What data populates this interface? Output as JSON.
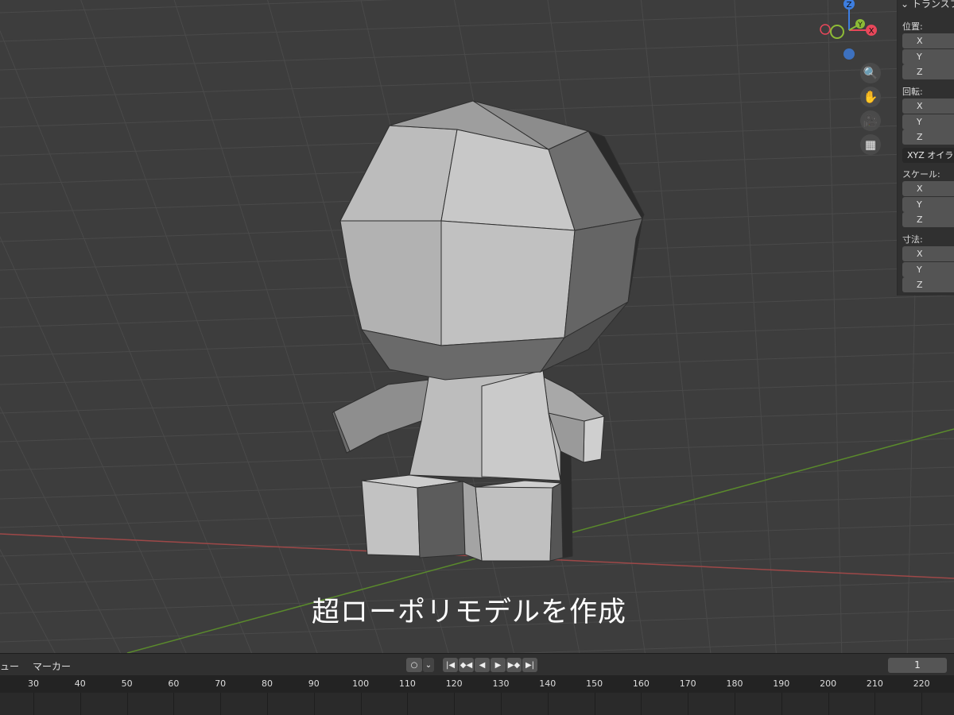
{
  "caption": "超ローポリモデルを作成",
  "gizmo": {
    "axis_z": "Z",
    "axis_x": "X",
    "axis_y": "Y",
    "colors": {
      "x": "#e8475a",
      "y": "#8dbb36",
      "z": "#3d7ee0"
    }
  },
  "nav_buttons": [
    {
      "name": "zoom-icon",
      "glyph": "🔍"
    },
    {
      "name": "pan-hand-icon",
      "glyph": "✋"
    },
    {
      "name": "camera-icon",
      "glyph": "🎥"
    },
    {
      "name": "grid-ortho-icon",
      "glyph": "▦"
    }
  ],
  "npanel": {
    "header": "トランスフ",
    "location_label": "位置:",
    "rotation_label": "回転:",
    "rotation_mode": "XYZ オイラ",
    "scale_label": "スケール:",
    "dimensions_label": "寸法:",
    "axis_x": "X",
    "axis_y": "Y",
    "axis_z": "Z"
  },
  "timeline": {
    "menu_view": "ビュー",
    "menu_marker": "マーカー",
    "current_frame": "1",
    "ticks": [
      "30",
      "40",
      "50",
      "60",
      "70",
      "80",
      "90",
      "100",
      "110",
      "120",
      "130",
      "140",
      "150",
      "160",
      "170",
      "180",
      "190",
      "200",
      "210",
      "220"
    ],
    "icons": {
      "record": "○",
      "dropdown": "⌄",
      "jump_start": "|◀",
      "prev_key": "◆◀",
      "play_back": "◀",
      "play": "▶",
      "next_key": "▶◆",
      "jump_end": "▶|"
    }
  },
  "colors": {
    "viewport_bg": "#3d3d3d",
    "axis_x_line": "#a34a4a",
    "axis_y_line": "#5b8a2e",
    "model_light": "#b8b8b8"
  }
}
